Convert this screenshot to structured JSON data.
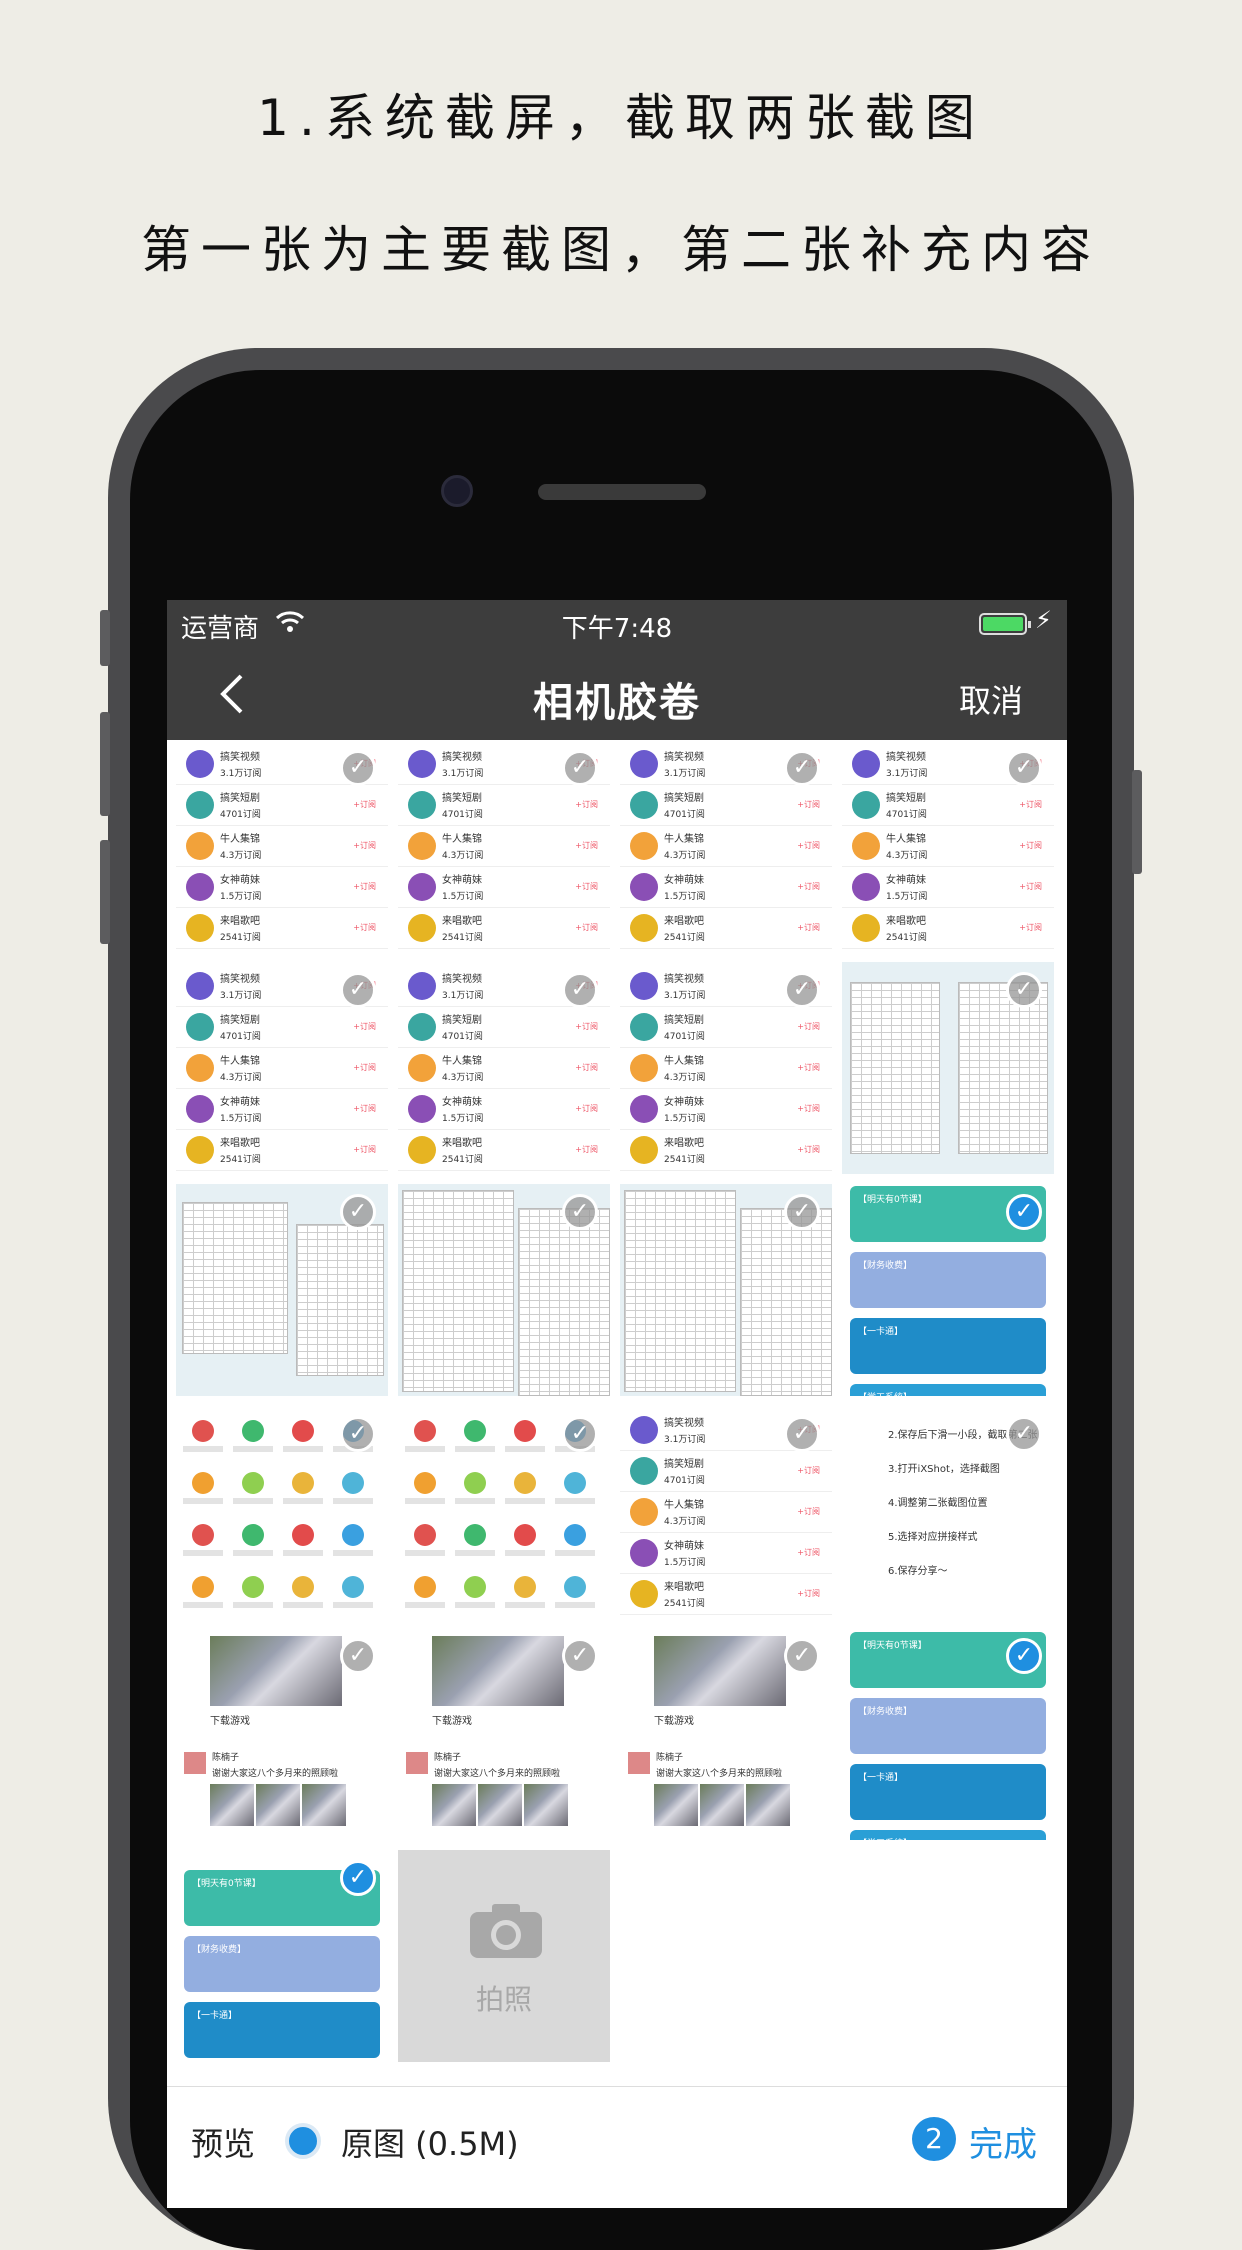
{
  "headline": {
    "line1": "1.系统截屏，截取两张截图",
    "line2": "第一张为主要截图，第二张补充内容"
  },
  "status": {
    "carrier": "运营商",
    "time": "下午7:48"
  },
  "nav": {
    "title": "相机胶卷",
    "cancel": "取消",
    "back_icon": "chevron-left-icon"
  },
  "list_items": [
    {
      "name": "搞笑视频",
      "count": "3.1万订阅",
      "color": "#6a5acd"
    },
    {
      "name": "搞笑短剧",
      "count": "4701订阅",
      "color": "#3aa6a0"
    },
    {
      "name": "牛人集锦",
      "count": "4.3万订阅",
      "color": "#f2a23a"
    },
    {
      "name": "女神萌妹",
      "count": "1.5万订阅",
      "color": "#8a4fb5"
    },
    {
      "name": "来唱歌吧",
      "count": "2541订阅",
      "color": "#e6b422"
    }
  ],
  "subscribe_label": "+订阅",
  "cards": [
    {
      "title": "【明天有0节课】",
      "color": "#3dbba8"
    },
    {
      "title": "【财务收费】",
      "color": "#93aee0"
    },
    {
      "title": "【一卡通】",
      "color": "#1f8cc8"
    },
    {
      "title": "【学工系统】",
      "color": "#2a9fd6"
    }
  ],
  "notes": [
    "2.保存后下滑一小段，截取第二张",
    "3.打开iXShot，选择截图",
    "4.调整第二张截图位置",
    "5.选择对应拼接样式",
    "6.保存分享～"
  ],
  "feed": {
    "game": "下载游戏",
    "user": "陈楠子",
    "post": "谢谢大家这八个多月来的照顾啦"
  },
  "camera_cell": {
    "label": "拍照"
  },
  "toolbar": {
    "preview": "预览",
    "original": "原图 (0.5M)",
    "count": "2",
    "done": "完成"
  },
  "colors": {
    "accent": "#1f8fe0",
    "bar": "#3d3d3d"
  }
}
